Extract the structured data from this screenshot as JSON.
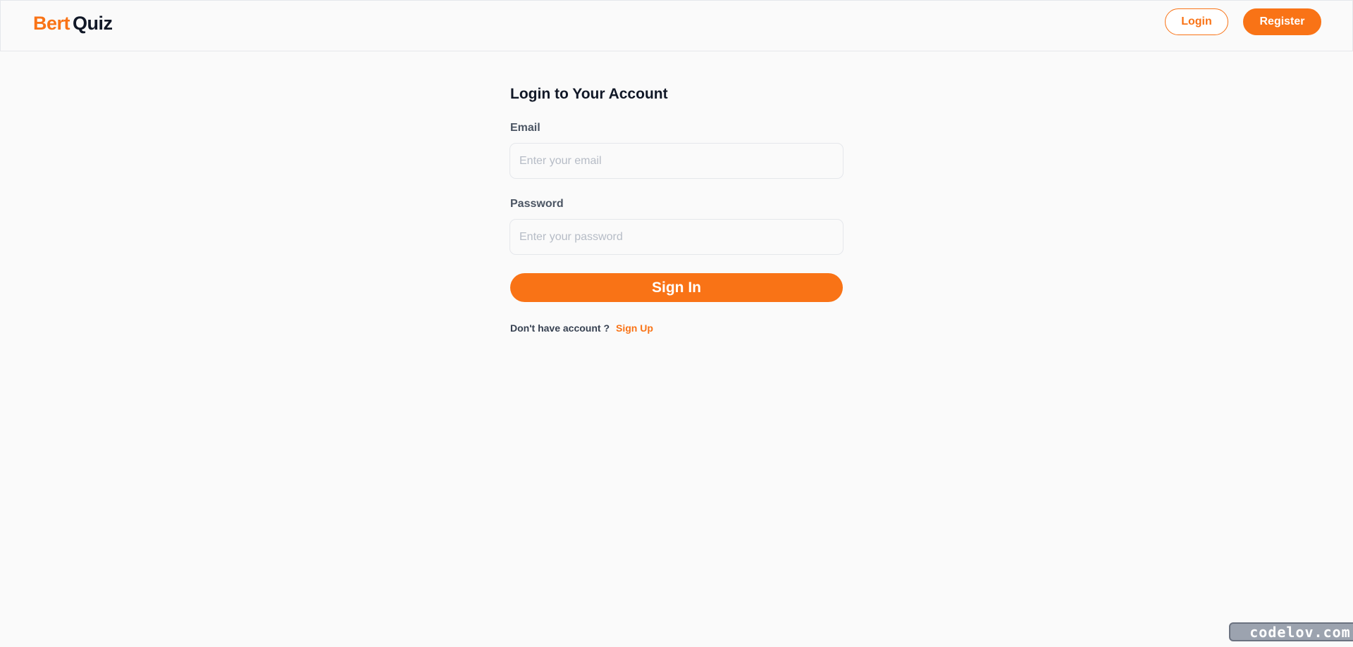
{
  "header": {
    "logo_brand": "Bert",
    "logo_rest": "Quiz",
    "login_label": "Login",
    "register_label": "Register"
  },
  "form": {
    "title": "Login to Your Account",
    "email_label": "Email",
    "email_placeholder": "Enter your email",
    "email_value": "",
    "password_label": "Password",
    "password_placeholder": "Enter your password",
    "password_value": "",
    "submit_label": "Sign In",
    "signup_prompt": "Don't have account ?",
    "signup_link": "Sign Up"
  },
  "watermark": {
    "text": "codelov.com"
  },
  "colors": {
    "accent": "#f97316",
    "background": "#fafafa",
    "border": "#e5e7eb",
    "text_dark": "#111827",
    "text_label": "#4b5563"
  }
}
